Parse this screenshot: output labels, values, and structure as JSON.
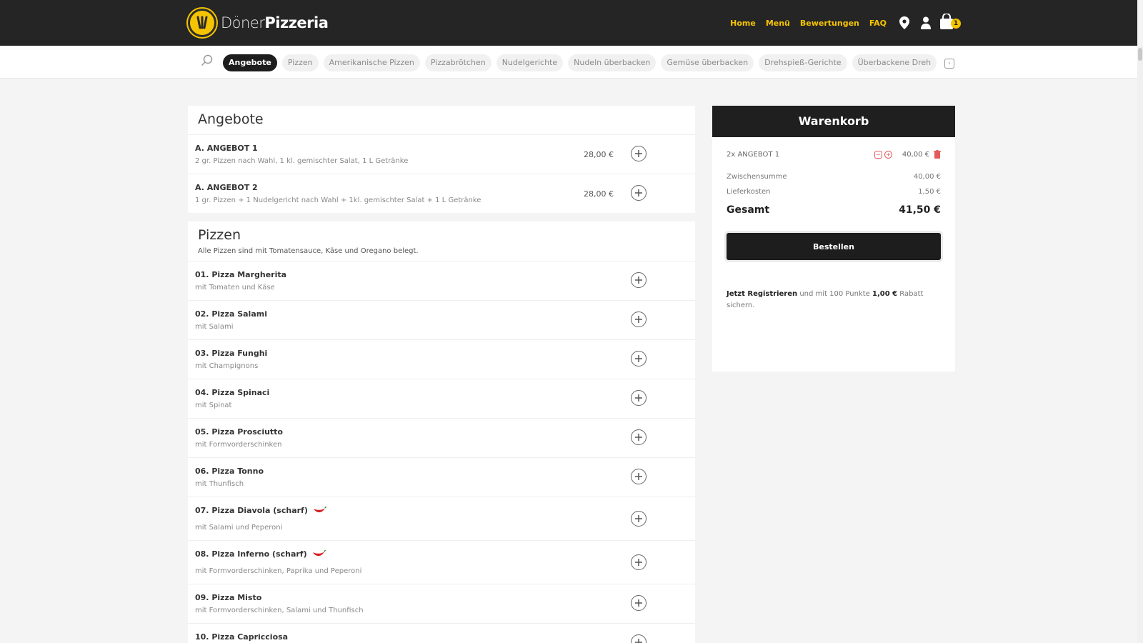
{
  "header": {
    "logo_thin": "Döner",
    "logo_bold": "Pizzeria",
    "nav": [
      "Home",
      "Menü",
      "Bewertungen",
      "FAQ"
    ],
    "cart_count": "1"
  },
  "categories": [
    "Angebote",
    "Pizzen",
    "Amerikanische Pizzen",
    "Pizzabrötchen",
    "Nudelgerichte",
    "Nudeln überbacken",
    "Gemüse überbacken",
    "Drehspieß-Gerichte",
    "Überbackene Dreh"
  ],
  "sections": {
    "angebote": {
      "title": "Angebote",
      "items": [
        {
          "name": "A. ANGEBOT 1",
          "desc": "2 gr. Pizzen nach Wahl, 1 kl. gemischter Salat, 1 L Getränke",
          "price": "28,00 €"
        },
        {
          "name": "A. ANGEBOT 2",
          "desc": "1 gr. Pizzen + 1 Nudelgericht nach Wahl + 1kl. gemischter Salat + 1 L Getränke",
          "price": "28,00 €"
        }
      ]
    },
    "pizzen": {
      "title": "Pizzen",
      "desc": "Alle Pizzen sind mit Tomatensauce, Käse und Oregano belegt.",
      "items": [
        {
          "name": "01. Pizza Margherita",
          "desc": "mit Tomaten und Käse"
        },
        {
          "name": "02. Pizza Salami",
          "desc": "mit Salami"
        },
        {
          "name": "03. Pizza Funghi",
          "desc": "mit Champignons"
        },
        {
          "name": "04. Pizza Spinaci",
          "desc": "mit Spinat"
        },
        {
          "name": "05. Pizza Prosciutto",
          "desc": "mit Formvorderschinken"
        },
        {
          "name": "06. Pizza Tonno",
          "desc": "mit Thunfisch"
        },
        {
          "name": "07. Pizza Diavola (scharf)",
          "desc": "mit Salami und Peperoni"
        },
        {
          "name": "08. Pizza Inferno (scharf)",
          "desc": "mit Formvorderschinken, Paprika und Peperoni"
        },
        {
          "name": "09. Pizza Misto",
          "desc": "mit Formvorderschinken, Salami und Thunfisch"
        },
        {
          "name": "10. Pizza Capricciosa",
          "desc": ""
        }
      ]
    }
  },
  "cart": {
    "title": "Warenkorb",
    "line": {
      "qty": "2x ANGEBOT 1",
      "price": "40,00 €"
    },
    "subtotal_label": "Zwischensumme",
    "subtotal": "40,00 €",
    "delivery_label": "Lieferkosten",
    "delivery": "1,50 €",
    "total_label": "Gesamt",
    "total": "41,50 €",
    "order_button": "Bestellen",
    "promo_bold": "Jetzt Registrieren",
    "promo_mid": " und mit 100 Punkte ",
    "promo_amount": "1,00 €",
    "promo_end": " Rabatt sichern."
  },
  "colors": {
    "accent": "#f5c400",
    "dark": "#1f1f1f",
    "danger": "#e35b5b"
  }
}
